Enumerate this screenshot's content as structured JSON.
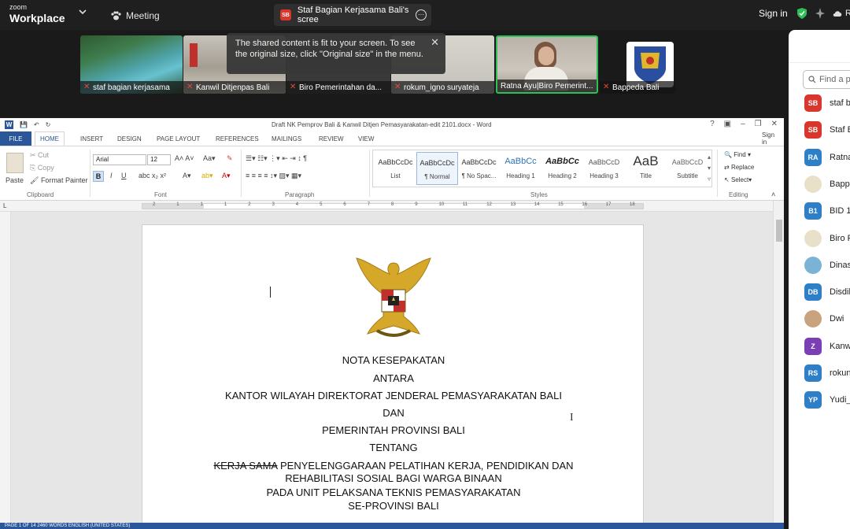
{
  "zoom": {
    "brand_top": "zoom",
    "brand_bottom": "Workplace",
    "meeting_label": "Meeting",
    "share_badge": "SB",
    "share_title": "Staf Bagian Kerjasama Bali's scree",
    "sign_in": "Sign in",
    "cloud_label": "R"
  },
  "tooltip": {
    "text": "The shared content is fit to your screen. To see the original size, click \"Original size\" in the menu."
  },
  "video_tiles": [
    {
      "name": "staf bagian kerjasama"
    },
    {
      "name": "Kanwil Ditjenpas Bali"
    },
    {
      "name": "Biro Pemerintahan da..."
    },
    {
      "name": "rokum_igno suryateja"
    },
    {
      "name": "Ratna Ayu|Biro Pemerint..."
    },
    {
      "name": "Bappeda Bali"
    }
  ],
  "word": {
    "title": "Draft NK Pemprov Bali & Kanwil Ditjen Pemasyarakatan-edit 2101.docx - Word",
    "sign_in": "Sign in",
    "tabs": [
      "FILE",
      "HOME",
      "INSERT",
      "DESIGN",
      "PAGE LAYOUT",
      "REFERENCES",
      "MAILINGS",
      "REVIEW",
      "VIEW"
    ],
    "clipboard": {
      "paste": "Paste",
      "cut": "Cut",
      "copy": "Copy",
      "format_painter": "Format Painter",
      "label": "Clipboard"
    },
    "font": {
      "name": "Arial",
      "size": "12",
      "label": "Font",
      "bold": "B",
      "italic": "I",
      "underline": "U"
    },
    "paragraph_label": "Paragraph",
    "styles": [
      {
        "sample": "AaBbCcDc",
        "name": "List"
      },
      {
        "sample": "AaBbCcDc",
        "name": "¶ Normal"
      },
      {
        "sample": "AaBbCcDc",
        "name": "¶ No Spac..."
      },
      {
        "sample": "AaBbCc",
        "name": "Heading 1"
      },
      {
        "sample": "AaBbCc",
        "name": "Heading 2"
      },
      {
        "sample": "AaBbCcD",
        "name": "Heading 3"
      },
      {
        "sample": "AaB",
        "name": "Title"
      },
      {
        "sample": "AaBbCcD",
        "name": "Subtitle"
      }
    ],
    "styles_label": "Styles",
    "editing": {
      "find": "Find",
      "replace": "Replace",
      "select": "Select",
      "label": "Editing"
    },
    "ruler_numbers": [
      "2",
      "1",
      "1",
      "1",
      "2",
      "3",
      "4",
      "5",
      "6",
      "7",
      "8",
      "9",
      "10",
      "11",
      "12",
      "13",
      "14",
      "15",
      "16",
      "17",
      "18"
    ],
    "document": {
      "lines": [
        "NOTA KESEPAKATAN",
        "ANTARA",
        "KANTOR WILAYAH DIREKTORAT JENDERAL PEMASYARAKATAN BALI",
        "DAN",
        "PEMERINTAH PROVINSI BALI",
        "TENTANG"
      ],
      "struck": "KERJA SAMA",
      "line7_rest": " PENYELENGGARAAN PELATIHAN KERJA, PENDIDIKAN DAN",
      "line8": "REHABILITASI SOSIAL BAGI WARGA BINAAN",
      "line9": "PADA UNIT PELAKSANA TEKNIS PEMASYARAKATAN",
      "line10": "SE-PROVINSI BALI"
    },
    "status": "PAGE 1 OF 14    2460 WORDS    ENGLISH (UNITED STATES)"
  },
  "participants": {
    "search_placeholder": "Find a p",
    "list": [
      {
        "initials": "SB",
        "name": "staf b",
        "color": "#d9372d"
      },
      {
        "initials": "SB",
        "name": "Staf B",
        "color": "#d9372d"
      },
      {
        "initials": "RA",
        "name": "Ratna",
        "color": "#2d7fc8"
      },
      {
        "initials": "",
        "name": "Bapp",
        "color": "#e8e0c8"
      },
      {
        "initials": "B1",
        "name": "BID 1",
        "color": "#2d7fc8"
      },
      {
        "initials": "",
        "name": "Biro P",
        "color": "#e8e0c8"
      },
      {
        "initials": "",
        "name": "Dinas",
        "color": "#7ab3d6"
      },
      {
        "initials": "DB",
        "name": "Disdil",
        "color": "#2d7fc8"
      },
      {
        "initials": "",
        "name": "Dwi",
        "color": "#c9a27e"
      },
      {
        "initials": "Z",
        "name": "Kanw",
        "color": "#7b3fb5"
      },
      {
        "initials": "RS",
        "name": "rokun",
        "color": "#2d7fc8"
      },
      {
        "initials": "YP",
        "name": "Yudi_",
        "color": "#2d7fc8"
      }
    ]
  }
}
